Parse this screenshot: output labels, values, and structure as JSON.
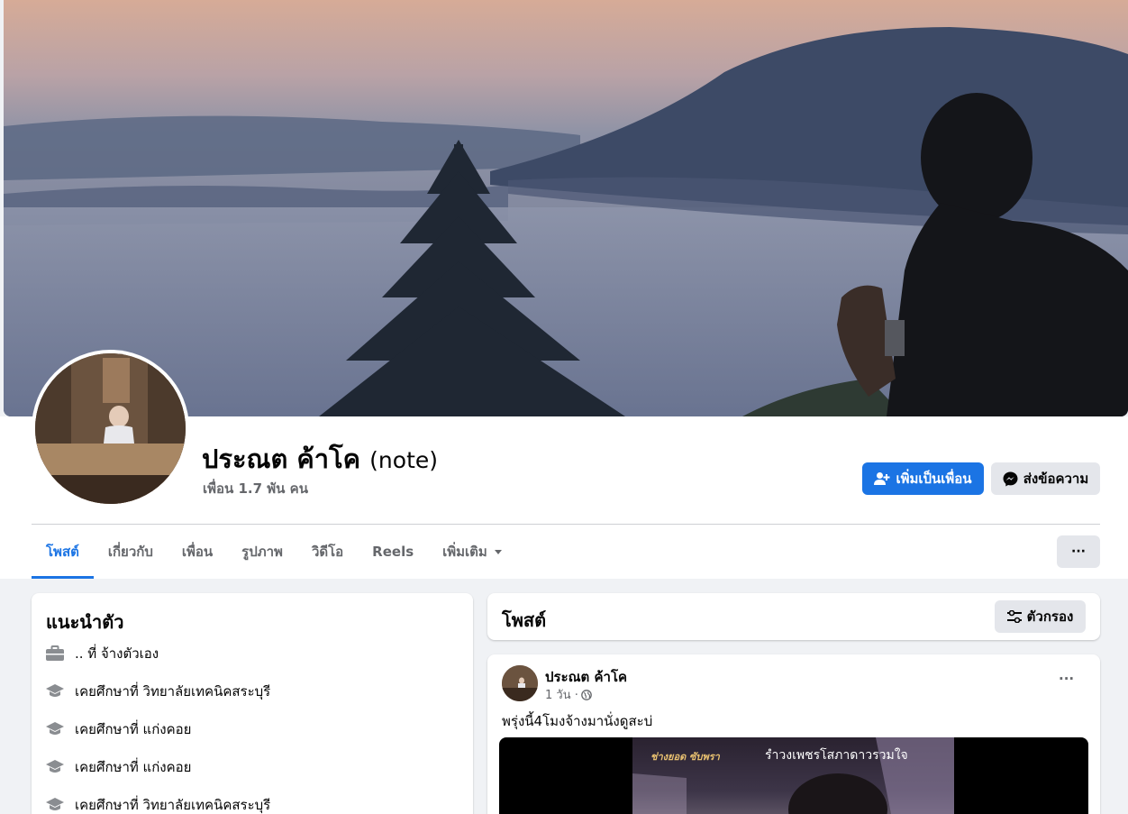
{
  "profile": {
    "name": "ประณต ค้าโค",
    "alternate_name": "(note)",
    "friends": "เพื่อน 1.7 พัน คน"
  },
  "actions": {
    "add_friend": "เพิ่มเป็นเพื่อน",
    "message": "ส่งข้อความ",
    "more": "···"
  },
  "tabs": [
    {
      "label": "โพสต์"
    },
    {
      "label": "เกี่ยวกับ"
    },
    {
      "label": "เพื่อน"
    },
    {
      "label": "รูปภาพ"
    },
    {
      "label": "วิดีโอ"
    },
    {
      "label": "Reels"
    },
    {
      "label": "เพิ่มเติม"
    }
  ],
  "intro": {
    "title": "แนะนำตัว",
    "items": [
      {
        "icon": "briefcase-icon",
        "text": ".. ที่ จ้างตัวเอง"
      },
      {
        "icon": "graduation-cap-icon",
        "text": "เคยศึกษาที่ วิทยาลัยเทคนิคสระบุรี"
      },
      {
        "icon": "graduation-cap-icon",
        "text": "เคยศึกษาที่ แก่งคอย"
      },
      {
        "icon": "graduation-cap-icon",
        "text": "เคยศึกษาที่ แก่งคอย"
      },
      {
        "icon": "graduation-cap-icon",
        "text": "เคยศึกษาที่ วิทยาลัยเทคนิคสระบุรี"
      }
    ]
  },
  "posts_header": {
    "title": "โพสต์",
    "filter_label": "ตัวกรอง"
  },
  "post": {
    "author": "ประณต ค้าโค",
    "time": "1 วัน ·",
    "text": "พรุ่งนี้4โมงจ้างมานั่งดูสะบ่",
    "media_caption_left": "ช่างยอด ซับพรา",
    "media_caption_right": "รำวงเพชรโสภาดาวรวมใจ",
    "more": "···"
  },
  "colors": {
    "accent": "#1b74e4",
    "background": "#f0f2f5",
    "secondary_text": "#65676b"
  }
}
